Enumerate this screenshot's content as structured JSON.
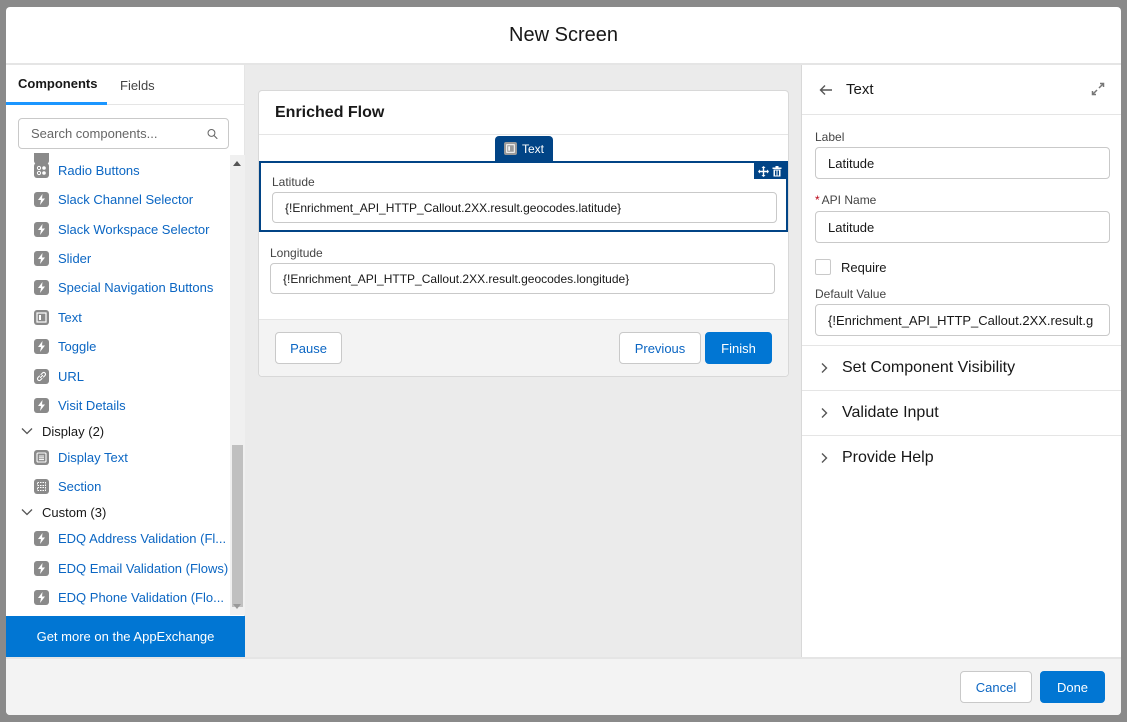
{
  "modal": {
    "title": "New Screen",
    "cancel_label": "Cancel",
    "done_label": "Done"
  },
  "left_panel": {
    "tabs": [
      {
        "label": "Components",
        "active": true
      },
      {
        "label": "Fields",
        "active": false
      }
    ],
    "search_placeholder": "Search components...",
    "items": [
      {
        "label": "Radio Buttons",
        "icon": "radio-buttons-icon"
      },
      {
        "label": "Slack Channel Selector",
        "icon": "lightning-icon"
      },
      {
        "label": "Slack Workspace Selector",
        "icon": "lightning-icon"
      },
      {
        "label": "Slider",
        "icon": "lightning-icon"
      },
      {
        "label": "Special Navigation Buttons",
        "icon": "lightning-icon"
      },
      {
        "label": "Text",
        "icon": "text-input-icon"
      },
      {
        "label": "Toggle",
        "icon": "lightning-icon"
      },
      {
        "label": "URL",
        "icon": "link-icon"
      },
      {
        "label": "Visit Details",
        "icon": "lightning-icon"
      }
    ],
    "groups": [
      {
        "label": "Display (2)",
        "items": [
          {
            "label": "Display Text",
            "icon": "display-text-icon"
          },
          {
            "label": "Section",
            "icon": "section-icon"
          }
        ]
      },
      {
        "label": "Custom (3)",
        "items": [
          {
            "label": "EDQ Address Validation (Fl...",
            "icon": "lightning-icon"
          },
          {
            "label": "EDQ Email Validation (Flows)",
            "icon": "lightning-icon"
          },
          {
            "label": "EDQ Phone Validation (Flo...",
            "icon": "lightning-icon"
          }
        ]
      }
    ],
    "appexchange_label": "Get more on the AppExchange"
  },
  "canvas": {
    "screen_title": "Enriched Flow",
    "selected_tab_label": "Text",
    "fields": [
      {
        "label": "Latitude",
        "value": "{!Enrichment_API_HTTP_Callout.2XX.result.geocodes.latitude}",
        "selected": true
      },
      {
        "label": "Longitude",
        "value": "{!Enrichment_API_HTTP_Callout.2XX.result.geocodes.longitude}",
        "selected": false
      }
    ],
    "pause_label": "Pause",
    "previous_label": "Previous",
    "finish_label": "Finish"
  },
  "right_panel": {
    "title": "Text",
    "label_field": {
      "label": "Label",
      "value": "Latitude"
    },
    "api_name_field": {
      "label": "API Name",
      "required_marker": "*",
      "value": "Latitude"
    },
    "require_checkbox": {
      "label": "Require",
      "checked": false
    },
    "default_value_field": {
      "label": "Default Value",
      "value": "{!Enrichment_API_HTTP_Callout.2XX.result.g"
    },
    "sections": [
      {
        "label": "Set Component Visibility"
      },
      {
        "label": "Validate Input"
      },
      {
        "label": "Provide Help"
      }
    ]
  },
  "colors": {
    "brand": "#0176d3",
    "selected_border": "#014486",
    "link": "#0b66c3",
    "tab_active_underline": "#1b96ff",
    "required": "#ba0517"
  }
}
